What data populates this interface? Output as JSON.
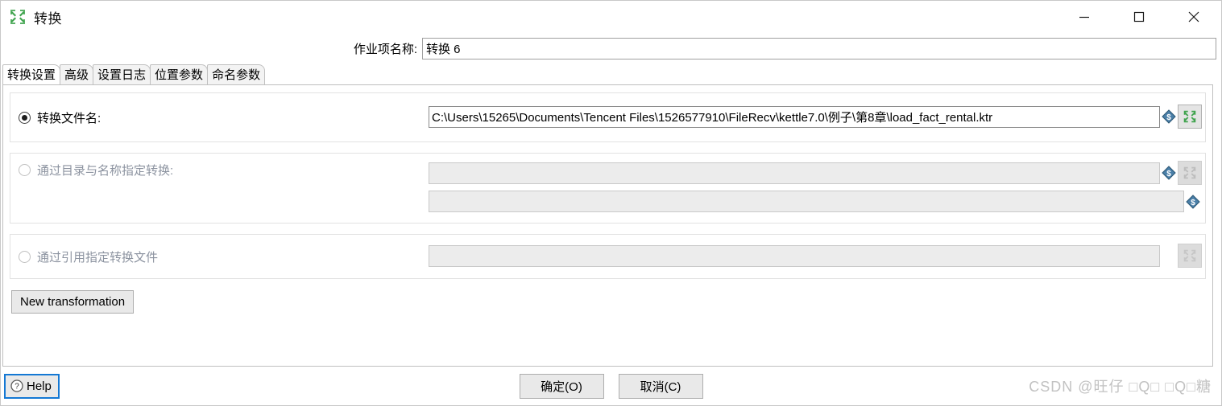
{
  "window": {
    "title": "转换",
    "icon": "transform-converge-icon",
    "controls": {
      "minimize": "minimize-icon",
      "maximize": "maximize-icon",
      "close": "close-icon"
    }
  },
  "job_name": {
    "label": "作业项名称:",
    "value": "转换 6"
  },
  "tabs": [
    {
      "label": "转换设置",
      "active": true
    },
    {
      "label": "高级",
      "active": false
    },
    {
      "label": "设置日志",
      "active": false
    },
    {
      "label": "位置参数",
      "active": false
    },
    {
      "label": "命名参数",
      "active": false
    }
  ],
  "options": [
    {
      "id": "by-filename",
      "label": "转换文件名:",
      "selected": true,
      "enabled": true,
      "value": "C:\\Users\\15265\\Documents\\Tencent Files\\1526577910\\FileRecv\\kettle7.0\\例子\\第8章\\load_fact_rental.ktr"
    },
    {
      "id": "by-directory-and-name",
      "label": "通过目录与名称指定转换:",
      "selected": false,
      "enabled": false,
      "value": "",
      "value2": ""
    },
    {
      "id": "by-reference",
      "label": "通过引用指定转换文件",
      "selected": false,
      "enabled": false,
      "value": ""
    }
  ],
  "buttons": {
    "new_transformation": "New transformation",
    "help": "Help",
    "ok": "确定(O)",
    "cancel": "取消(C)"
  },
  "watermark": "CSDN @旺仔 □Q□ □Q□糖",
  "colors": {
    "accent_green": "#3fa34d",
    "variable_blue": "#2a6496",
    "focus_blue": "#1478d4",
    "watermark_gray": "#c2c2c2"
  }
}
